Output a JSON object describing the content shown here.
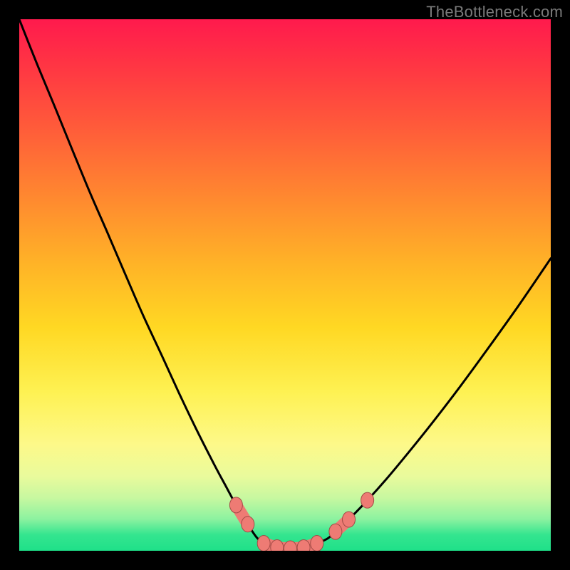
{
  "watermark": "TheBottleneck.com",
  "colors": {
    "frame": "#000000",
    "curve": "#000000",
    "marker_fill": "#ee7b74",
    "marker_stroke": "#a24b46",
    "gradient_top": "#ff1a4d",
    "gradient_mid": "#ffd823",
    "gradient_bottom": "#1fe089"
  },
  "chart_data": {
    "type": "line",
    "title": "",
    "xlabel": "",
    "ylabel": "",
    "xlim": [
      0,
      100
    ],
    "ylim": [
      0,
      100
    ],
    "grid": false,
    "curves": [
      {
        "name": "left",
        "x": [
          0.0,
          3.3,
          6.7,
          10.0,
          13.3,
          16.7,
          20.0,
          23.3,
          26.7,
          30.0,
          33.3,
          36.7,
          38.9,
          40.8,
          43.0,
          44.6
        ],
        "y": [
          100,
          91.7,
          83.5,
          75.4,
          67.4,
          59.6,
          51.9,
          44.3,
          37.0,
          29.8,
          22.9,
          16.2,
          12.1,
          8.6,
          5.0,
          2.6
        ]
      },
      {
        "name": "bottom",
        "x": [
          44.6,
          46.0,
          48.5,
          51.0,
          53.5,
          56.0,
          58.0,
          59.5
        ],
        "y": [
          2.6,
          1.4,
          0.6,
          0.4,
          0.6,
          1.4,
          2.3,
          3.6
        ]
      },
      {
        "name": "right",
        "x": [
          59.5,
          62.0,
          65.5,
          69.0,
          73.0,
          77.5,
          82.5,
          88.0,
          94.0,
          100.0
        ],
        "y": [
          3.6,
          5.9,
          9.5,
          13.4,
          18.2,
          23.8,
          30.3,
          37.8,
          46.2,
          55.0
        ]
      }
    ],
    "markers": [
      {
        "x": 40.8,
        "y": 8.6
      },
      {
        "x": 43.0,
        "y": 5.0
      },
      {
        "x": 46.0,
        "y": 1.4
      },
      {
        "x": 48.5,
        "y": 0.6
      },
      {
        "x": 51.0,
        "y": 0.4
      },
      {
        "x": 53.5,
        "y": 0.6
      },
      {
        "x": 56.0,
        "y": 1.4
      },
      {
        "x": 59.5,
        "y": 3.6
      },
      {
        "x": 62.0,
        "y": 5.9
      },
      {
        "x": 65.5,
        "y": 9.5
      }
    ],
    "marker_clusters": [
      {
        "items": [
          0,
          1
        ]
      },
      {
        "items": [
          2,
          3,
          4,
          5,
          6
        ]
      },
      {
        "items": [
          7,
          8
        ]
      },
      {
        "items": [
          9
        ]
      }
    ]
  }
}
